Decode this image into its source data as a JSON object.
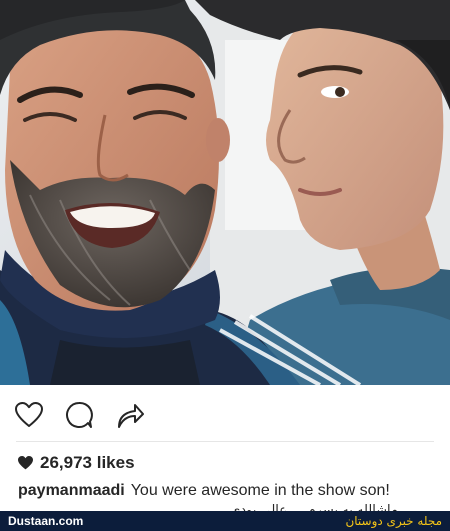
{
  "post": {
    "likes_count": "26,973",
    "likes_suffix": "likes",
    "author": "paymanmaadi",
    "caption_text": "You were  awesome in the show son!",
    "caption_overflow": "ماشالله به پسرم ... عالی بودی"
  },
  "actions": {
    "like_icon": "heart-outline-icon",
    "comment_icon": "comment-bubble-icon",
    "share_icon": "share-arrow-icon"
  },
  "watermark": {
    "left": "Dustaan.com",
    "right": "مجله خبری دوستان"
  },
  "colors": {
    "text": "#262626",
    "watermark_bg": "#0c1d3b",
    "watermark_accent": "#f5c518"
  }
}
